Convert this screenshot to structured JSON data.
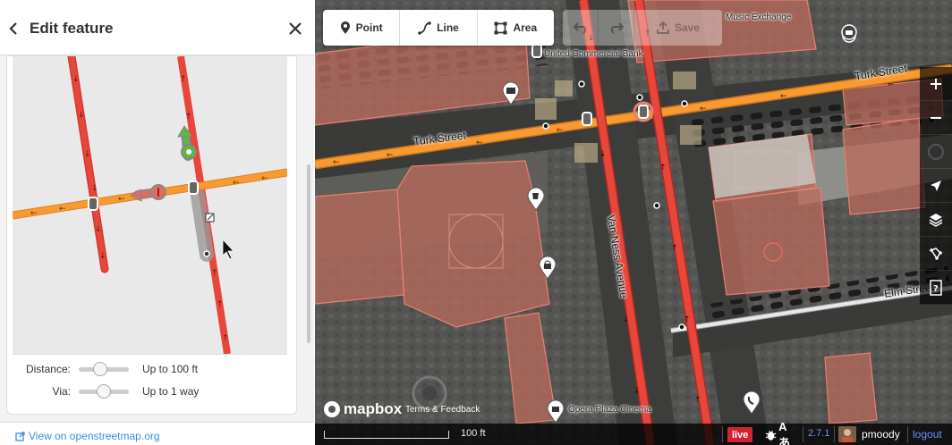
{
  "sidebar": {
    "title": "Edit feature",
    "turn_restrictions": {
      "distance_label": "Distance:",
      "distance_value": "Up to 100 ft",
      "distance_level": 0.4,
      "via_label": "Via:",
      "via_value": "Up to 1 way",
      "via_level": 0.5
    },
    "footer_link": "View on openstreetmap.org"
  },
  "toolbar": {
    "modes": [
      {
        "label": "Point",
        "icon": "point-icon"
      },
      {
        "label": "Line",
        "icon": "line-icon"
      },
      {
        "label": "Area",
        "icon": "area-icon"
      }
    ],
    "save_label": "Save"
  },
  "map": {
    "street_labels": [
      "Turk Street",
      "Turk Street",
      "Van Ness Avenue",
      "Elm Street"
    ],
    "poi_labels": [
      "United Commercial Bank",
      "Music Exchange",
      "Opera Plaza Cinema"
    ],
    "attribution": {
      "logo_text": "mapbox",
      "terms": "Terms & Feedback"
    },
    "scale_text": "100 ft",
    "colors": {
      "primary_road": "#e7463b",
      "secondary_road": "#f99a31",
      "building": "#e06e5f",
      "accent": "#7092ff"
    }
  },
  "footer": {
    "live": "live",
    "issues_glyphs": "Aあ",
    "version": "2.7.1",
    "username": "pmoody",
    "logout": "logout"
  }
}
